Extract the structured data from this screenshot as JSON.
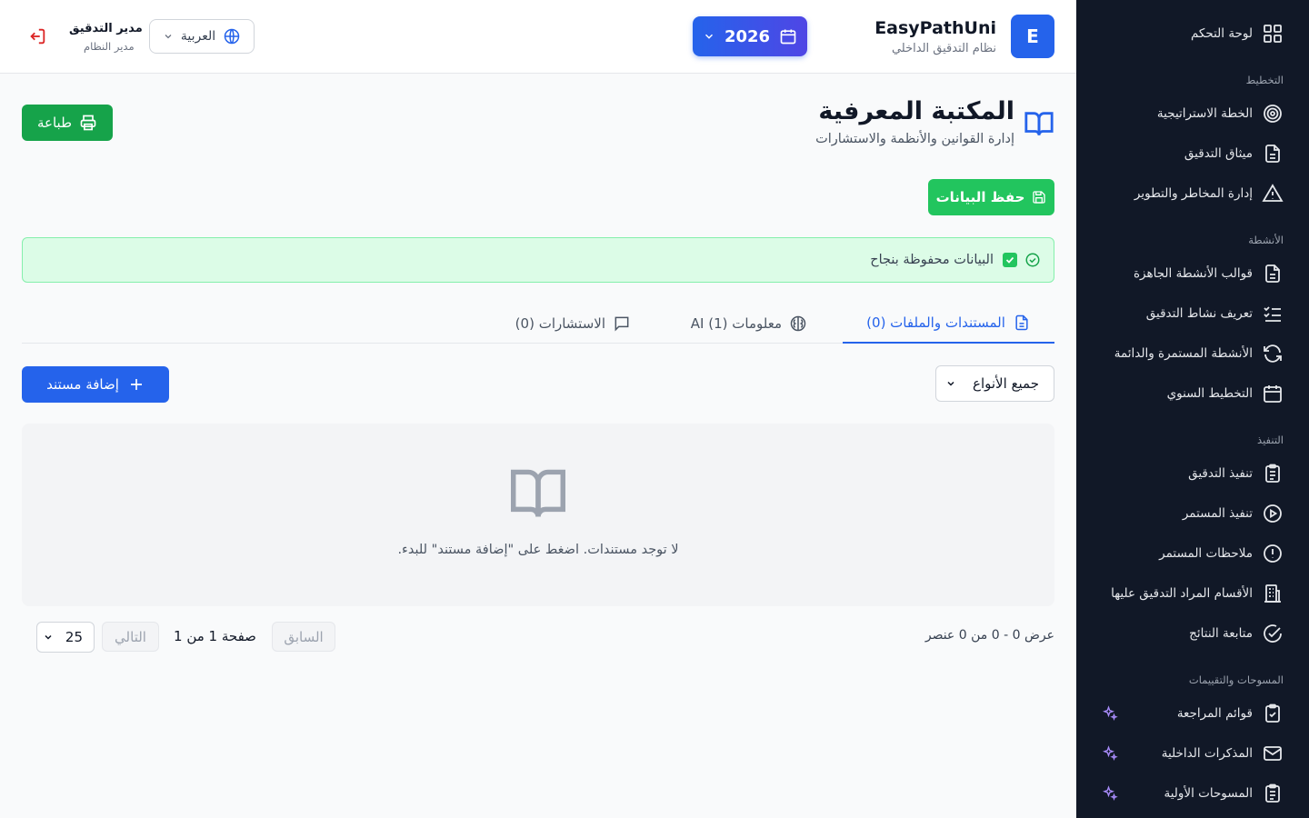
{
  "sidebar": {
    "dashboard": "لوحة التحكم",
    "sections": {
      "planning": "التخطيط",
      "activities": "الأنشطة",
      "execution": "التنفيذ",
      "surveys": "المسوحات والتقييمات"
    },
    "items": {
      "strategic_plan": "الخطة الاستراتيجية",
      "audit_charter": "ميثاق التدقيق",
      "risk_management": "إدارة المخاطر والتطوير",
      "activity_templates": "قوالب الأنشطة الجاهزة",
      "audit_activity_definition": "تعريف نشاط التدقيق",
      "continuous_activities": "الأنشطة المستمرة والدائمة",
      "annual_planning": "التخطيط السنوي",
      "audit_execution": "تنفيذ التدقيق",
      "continuous_execution": "تنفيذ المستمر",
      "continuous_notes": "ملاحظات المستمر",
      "audited_departments": "الأقسام المراد التدقيق عليها",
      "results_followup": "متابعة النتائج",
      "checklists": "قوائم المراجعة",
      "internal_memos": "المذكرات الداخلية",
      "preliminary_surveys": "المسوحات الأولية"
    }
  },
  "header": {
    "logo_letter": "E",
    "app_name": "EasyPathUni",
    "app_subtitle": "نظام التدقيق الداخلي",
    "year": "2026",
    "language": "العربية",
    "user_name": "مدير التدقيق",
    "user_role": "مدير النظام"
  },
  "page": {
    "title": "المكتبة المعرفية",
    "subtitle": "إدارة القوانين والأنظمة والاستشارات",
    "print_label": "طباعة",
    "save_label": "حفظ البيانات",
    "alert_text": "البيانات محفوظة بنجاح"
  },
  "tabs": {
    "documents": "المستندات والملفات (0)",
    "ai_info": "معلومات (1) AI",
    "consultations": "الاستشارات (0)"
  },
  "filters": {
    "type_select": "جميع الأنواع",
    "add_label": "إضافة مستند"
  },
  "empty": {
    "text": "لا توجد مستندات. اضغط على \"إضافة مستند\" للبدء."
  },
  "pagination": {
    "summary": "عرض 0 - 0 من 0 عنصر",
    "prev": "السابق",
    "page_info": "صفحة 1 من 1",
    "next": "التالي",
    "per_page": "25"
  },
  "colors": {
    "primary": "#2563eb",
    "sidebar_bg": "#111827",
    "success": "#22c55e",
    "print_green": "#16a34a",
    "danger": "#dc2626",
    "ai_accent": "#a78bfa"
  }
}
